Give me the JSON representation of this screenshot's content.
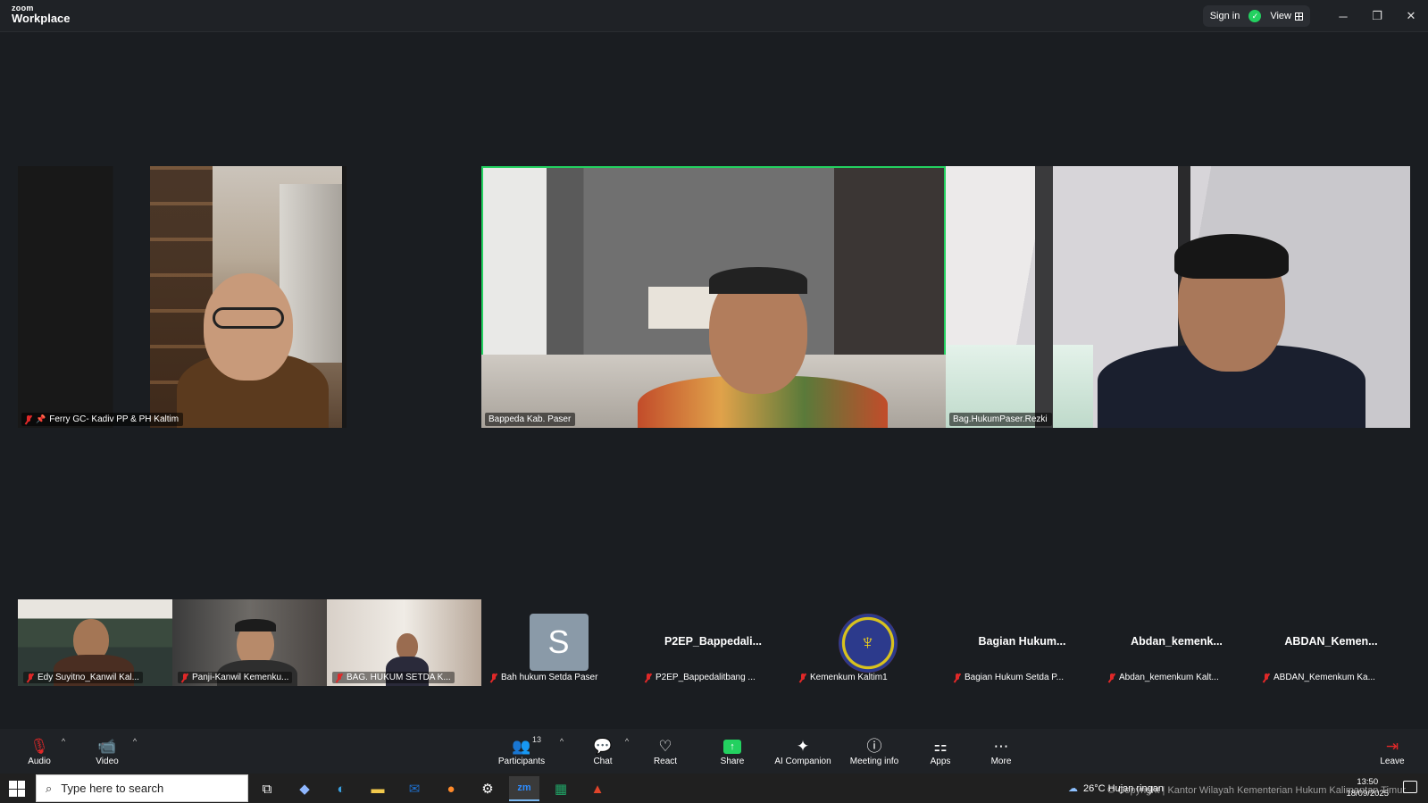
{
  "app": {
    "logo_small": "zoom",
    "logo_big": "Workplace",
    "sign_in": "Sign in",
    "view": "View"
  },
  "gallery": [
    {
      "name": "Ferry GC- Kadiv PP & PH Kaltim",
      "muted": true,
      "pinned": true
    },
    {
      "name": "Bappeda Kab. Paser",
      "muted": false,
      "active_speaker": true
    },
    {
      "name": "Bag.HukumPaser.Rezki",
      "muted": false
    }
  ],
  "thumbnails": [
    {
      "name": "Edy Suyitno_Kanwil Kal...",
      "type": "video"
    },
    {
      "name": "Panji-Kanwil Kemenku...",
      "type": "video"
    },
    {
      "name": "BAG. HUKUM SETDA K...",
      "type": "video"
    },
    {
      "name": "Bah hukum Setda Paser",
      "type": "avatar",
      "avatar_letter": "S"
    },
    {
      "name": "P2EP_Bappedalitbang ...",
      "type": "name",
      "display_name": "P2EP_Bappedali..."
    },
    {
      "name": "Kemenkum Kaltim1",
      "type": "logo"
    },
    {
      "name": "Bagian Hukum Setda P...",
      "type": "name",
      "display_name": "Bagian  Hukum..."
    },
    {
      "name": "Abdan_kemenkum Kalt...",
      "type": "name",
      "display_name": "Abdan_kemenk..."
    },
    {
      "name": "ABDAN_Kemenkum Ka...",
      "type": "name",
      "display_name": "ABDAN_Kemen..."
    }
  ],
  "controls": {
    "audio": "Audio",
    "video": "Video",
    "participants": "Participants",
    "participants_count": "13",
    "chat": "Chat",
    "react": "React",
    "share": "Share",
    "ai_companion": "AI Companion",
    "meeting_info": "Meeting info",
    "apps": "Apps",
    "more": "More",
    "leave": "Leave"
  },
  "taskbar": {
    "search_placeholder": "Type here to search",
    "weather": "26°C  Hujan ringan",
    "time": "13:50",
    "date": "18/09/2025",
    "watermark": "© Copyright | Kantor Wilayah Kementerian Hukum Kalimantan Timur",
    "notification_count": "2"
  },
  "colors": {
    "active_speaker": "#23d160",
    "muted": "#e02828",
    "share": "#23d160"
  }
}
